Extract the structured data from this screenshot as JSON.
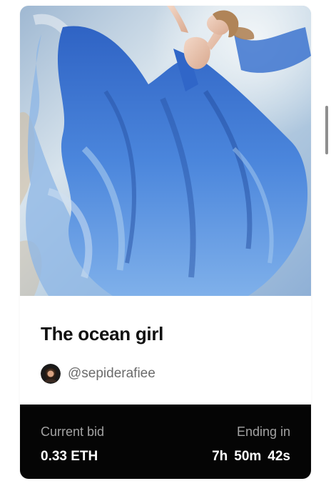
{
  "nft": {
    "title": "The ocean girl",
    "creator_handle": "@sepiderafiee",
    "artwork_icon": "painting-woman-blue-dress"
  },
  "bid": {
    "current_bid_label": "Current bid",
    "current_bid_value": "0.33 ETH",
    "ending_label": "Ending in",
    "hours": "7h",
    "minutes": "50m",
    "seconds": "42s"
  },
  "colors": {
    "panel_background": "#050505",
    "label_gray": "#a3a3a3",
    "handle_gray": "#6b6b6b",
    "dress_blue": "#3e78d4"
  }
}
